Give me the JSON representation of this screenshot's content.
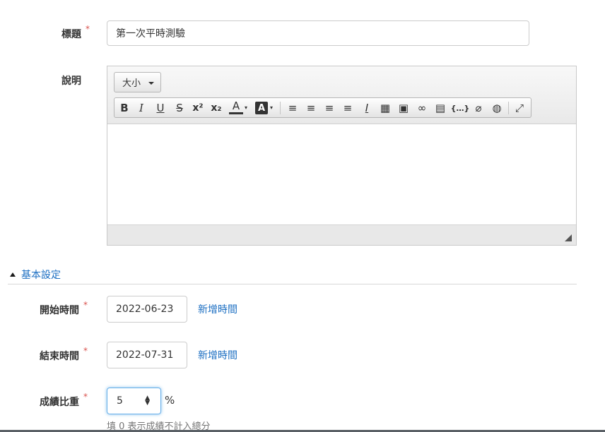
{
  "form": {
    "title": {
      "label": "標題",
      "required_mark": "*",
      "value": "第一次平時測驗"
    },
    "description": {
      "label": "說明"
    },
    "editor": {
      "size_combo": "大小",
      "toolbar": [
        {
          "id": "bold",
          "glyph": "B",
          "icon": "bold-icon"
        },
        {
          "id": "italic",
          "glyph": "I",
          "icon": "italic-icon"
        },
        {
          "id": "underline",
          "glyph": "U",
          "icon": "underline-icon"
        },
        {
          "id": "strike",
          "glyph": "S",
          "icon": "strikethrough-icon"
        },
        {
          "id": "superscript",
          "glyph": "x²",
          "icon": "superscript-icon"
        },
        {
          "id": "subscript",
          "glyph": "x₂",
          "icon": "subscript-icon"
        },
        {
          "id": "text-color",
          "glyph": "A",
          "icon": "text-color-icon"
        },
        {
          "id": "bg-color",
          "glyph": "A",
          "icon": "background-color-icon"
        },
        {
          "id": "numbered-list",
          "glyph": "≡",
          "icon": "numbered-list-icon"
        },
        {
          "id": "bulleted-list",
          "glyph": "≡",
          "icon": "bulleted-list-icon"
        },
        {
          "id": "align-left",
          "glyph": "≡",
          "icon": "align-left-icon"
        },
        {
          "id": "align-center",
          "glyph": "≡",
          "icon": "align-center-icon"
        },
        {
          "id": "remove-format",
          "glyph": "I",
          "icon": "remove-format-icon"
        },
        {
          "id": "table",
          "glyph": "▦",
          "icon": "table-icon"
        },
        {
          "id": "image",
          "glyph": "▣",
          "icon": "image-icon"
        },
        {
          "id": "link",
          "glyph": "∞",
          "icon": "link-icon"
        },
        {
          "id": "video",
          "glyph": "▤",
          "icon": "video-icon"
        },
        {
          "id": "code",
          "glyph": "{…}",
          "icon": "code-snippet-icon"
        },
        {
          "id": "attach",
          "glyph": "⌀",
          "icon": "attachment-icon"
        },
        {
          "id": "globe",
          "glyph": "◍",
          "icon": "globe-icon"
        },
        {
          "id": "maximize",
          "glyph": "⤢",
          "icon": "maximize-icon"
        }
      ]
    },
    "section": {
      "label": "基本設定"
    },
    "start_time": {
      "label": "開始時間",
      "required_mark": "*",
      "value": "2022-06-23",
      "add_link": "新增時間"
    },
    "end_time": {
      "label": "結束時間",
      "required_mark": "*",
      "value": "2022-07-31",
      "add_link": "新增時間"
    },
    "weight": {
      "label": "成績比重",
      "required_mark": "*",
      "value": "5",
      "unit": "%",
      "help": "填 0 表示成績不計入總分"
    }
  }
}
